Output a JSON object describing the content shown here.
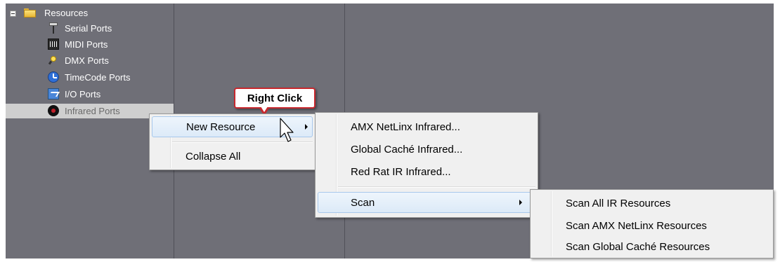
{
  "tree": {
    "root_label": "Resources",
    "items": [
      {
        "label": "Serial Ports",
        "icon": "serial-port-icon"
      },
      {
        "label": "MIDI Ports",
        "icon": "midi-port-icon"
      },
      {
        "label": "DMX Ports",
        "icon": "dmx-port-icon"
      },
      {
        "label": "TimeCode Ports",
        "icon": "timecode-port-icon"
      },
      {
        "label": "I/O Ports",
        "icon": "io-port-icon"
      },
      {
        "label": "Infrared Ports",
        "icon": "infrared-port-icon"
      }
    ]
  },
  "callout": {
    "text": "Right Click"
  },
  "context_menu": {
    "new_resource": "New Resource",
    "collapse_all": "Collapse All"
  },
  "new_resource_menu": {
    "items": [
      "AMX NetLinx Infrared...",
      "Global Caché Infrared...",
      "Red Rat IR Infrared..."
    ],
    "scan": "Scan"
  },
  "scan_menu": {
    "items": [
      "Scan All IR Resources",
      "Scan AMX NetLinx Resources",
      "Scan Global Caché Resources"
    ]
  },
  "colors": {
    "background": "#6f6f77",
    "menu": "#f0f0f0",
    "highlight": "#dceaf8",
    "callout_border": "#c8282e"
  }
}
